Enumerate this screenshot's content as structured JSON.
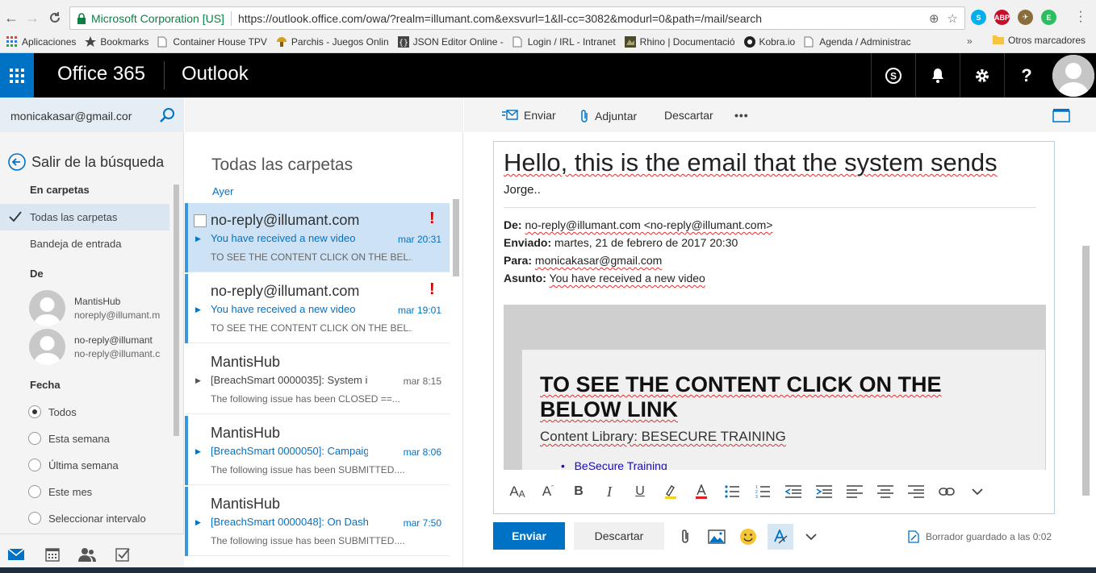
{
  "browser": {
    "secure_label": "Microsoft Corporation [US]",
    "url": "https://outlook.office.com/owa/?realm=illumant.com&exsvurl=1&ll-cc=3082&modurl=0&path=/mail/search",
    "extensions": [
      {
        "name": "skype-extension-icon",
        "color": "#00aff0",
        "glyph": "S"
      },
      {
        "name": "adblock-plus-icon",
        "color": "#c70d2c",
        "glyph": "ABP"
      },
      {
        "name": "rocket-extension-icon",
        "color": "#8a6d3b",
        "glyph": "✈"
      },
      {
        "name": "evernote-extension-icon",
        "color": "#2dbe60",
        "glyph": "E"
      }
    ],
    "bookmarks": {
      "apps": "Aplicaciones",
      "items": [
        {
          "label": "Bookmarks",
          "icon": "star-icon"
        },
        {
          "label": "Container House TPV",
          "icon": "page-icon"
        },
        {
          "label": "Parchis - Juegos Onlin",
          "icon": "mushroom-icon"
        },
        {
          "label": "JSON Editor Online -",
          "icon": "braces-icon"
        },
        {
          "label": "Login / IRL - Intranet",
          "icon": "page-icon"
        },
        {
          "label": "Rhino | Documentació",
          "icon": "rhino-icon"
        },
        {
          "label": "Kobra.io",
          "icon": "kobra-icon"
        },
        {
          "label": "Agenda / Administrac",
          "icon": "page-icon"
        }
      ],
      "more": "»",
      "other": "Otros marcadores"
    }
  },
  "header": {
    "brand": "Office 365",
    "app": "Outlook"
  },
  "left": {
    "account": "monicakasar@gmail.cor",
    "exit_search": "Salir de la búsqueda",
    "in_folders_label": "En carpetas",
    "folders": [
      {
        "label": "Todas las carpetas",
        "selected": true
      },
      {
        "label": "Bandeja de entrada",
        "selected": false
      }
    ],
    "from_label": "De",
    "senders": [
      {
        "name": "MantisHub",
        "email": "noreply@illumant.m"
      },
      {
        "name": "no-reply@illumant",
        "email": "no-reply@illumant.c"
      }
    ],
    "date_label": "Fecha",
    "date_options": [
      {
        "label": "Todos",
        "selected": true
      },
      {
        "label": "Esta semana",
        "selected": false
      },
      {
        "label": "Última semana",
        "selected": false
      },
      {
        "label": "Este mes",
        "selected": false
      },
      {
        "label": "Seleccionar intervalo",
        "selected": false
      }
    ]
  },
  "list": {
    "title": "Todas las carpetas",
    "group": "Ayer",
    "messages": [
      {
        "from": "no-reply@illumant.com",
        "subject": "You have received a new video",
        "time": "mar 20:31",
        "preview": "TO SEE THE CONTENT CLICK ON THE BEL...",
        "flag": "!",
        "unread": true,
        "selected": true
      },
      {
        "from": "no-reply@illumant.com",
        "subject": "You have received a new video",
        "time": "mar 19:01",
        "preview": "TO SEE THE CONTENT CLICK ON THE BEL...",
        "flag": "!",
        "unread": true,
        "selected": false
      },
      {
        "from": "MantisHub",
        "subject": "[BreachSmart 0000035]: System is",
        "time": "mar 8:15",
        "preview": "The following issue has been CLOSED  ==...",
        "flag": "",
        "unread": false,
        "selected": false
      },
      {
        "from": "MantisHub",
        "subject": "[BreachSmart 0000050]: Campaig",
        "time": "mar 8:06",
        "preview": "The following issue has been SUBMITTED....",
        "flag": "",
        "unread": true,
        "selected": false
      },
      {
        "from": "MantisHub",
        "subject": "[BreachSmart 0000048]: On Dash",
        "time": "mar 7:50",
        "preview": "The following issue has been SUBMITTED....",
        "flag": "",
        "unread": true,
        "selected": false
      }
    ]
  },
  "compose": {
    "toolbar": {
      "send": "Enviar",
      "attach": "Adjuntar",
      "discard": "Descartar",
      "more": "•••"
    },
    "body_heading": "Hello, this is the email that the system sends",
    "signature": "Jorge..",
    "meta": {
      "from_label": "De:",
      "from_value": "no-reply@illumant.com <no-reply@illumant.com>",
      "sent_label": "Enviado:",
      "sent_value": "martes, 21 de febrero de 2017 20:30",
      "to_label": "Para:",
      "to_value": "monicakasar@gmail.com",
      "subject_label": "Asunto:",
      "subject_value": "You have received a new video"
    },
    "email_card": {
      "title": "TO SEE THE CONTENT CLICK ON THE BELOW LINK",
      "library_label": "Content Library: BESECURE TRAINING",
      "link": "BeSecure Training"
    },
    "send_button": "Enviar",
    "discard_button": "Descartar",
    "draft_status": "Borrador guardado a las 0:02"
  }
}
